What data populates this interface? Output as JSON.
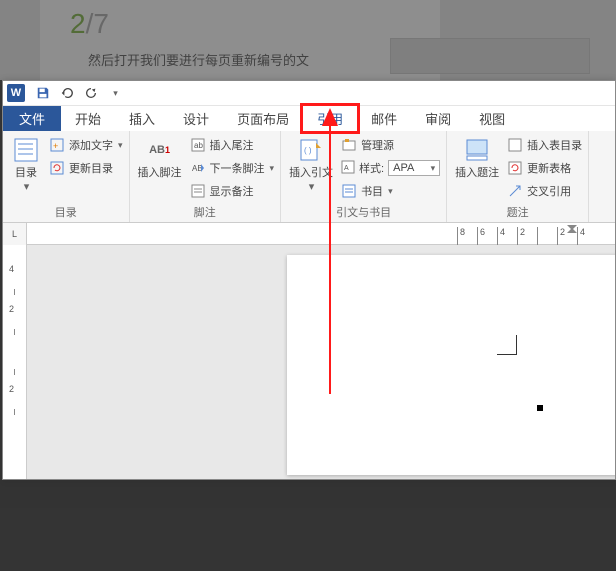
{
  "bg": {
    "counter_cur": "2",
    "counter_sep": "/",
    "counter_total": "7",
    "caption": "然后打开我们要进行每页重新编号的文"
  },
  "tabs": {
    "file": "文件",
    "home": "开始",
    "insert": "插入",
    "design": "设计",
    "layout": "页面布局",
    "references": "引用",
    "mailings": "邮件",
    "review": "审阅",
    "view": "视图"
  },
  "ribbon": {
    "toc": {
      "btn": "目录",
      "add_text": "添加文字",
      "update": "更新目录",
      "group": "目录"
    },
    "footnotes": {
      "insert": "插入脚注",
      "ab": "AB",
      "ab_sup": "1",
      "endnote": "插入尾注",
      "next": "下一条脚注",
      "show": "显示备注",
      "group": "脚注"
    },
    "citations": {
      "insert": "插入引文",
      "manage": "管理源",
      "style_label": "样式:",
      "style_value": "APA",
      "biblio": "书目",
      "group": "引文与书目"
    },
    "captions": {
      "insert": "插入题注",
      "table_of_figures": "插入表目录",
      "update_table": "更新表格",
      "cross_ref": "交叉引用",
      "group": "题注"
    }
  },
  "ruler": {
    "corner": "L",
    "h": [
      "8",
      "6",
      "4",
      "2",
      "",
      "2",
      "4"
    ],
    "v": [
      "4",
      "2",
      "",
      "2"
    ]
  }
}
